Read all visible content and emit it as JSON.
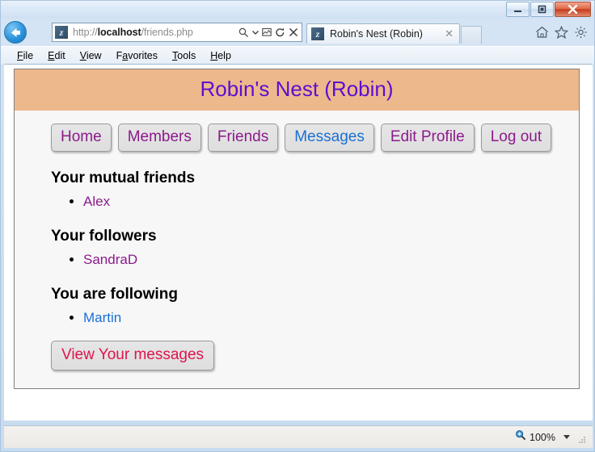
{
  "browser": {
    "window_buttons": {
      "minimize": "minimize-icon",
      "restore": "restore-icon",
      "close": "close-icon"
    },
    "navigation": {
      "back": "back-arrow-icon",
      "forward": "forward-arrow-icon"
    },
    "address": {
      "favicon": "z",
      "url_prefix": "http://",
      "url_host": "localhost",
      "url_path": "/friends.php",
      "full_url": "http://localhost/friends.php",
      "icons": [
        "search-icon",
        "dropdown-caret-icon",
        "compatibility-view-icon",
        "refresh-icon",
        "stop-icon"
      ]
    },
    "tab": {
      "favicon": "z",
      "title": "Robin's Nest (Robin)",
      "close_label": "✕"
    },
    "toolbar_icons": [
      "home-icon",
      "favorites-star-icon",
      "tools-gear-icon"
    ],
    "menu": [
      {
        "label": "File",
        "accel": "F",
        "rest": "ile"
      },
      {
        "label": "Edit",
        "accel": "E",
        "rest": "dit"
      },
      {
        "label": "View",
        "accel": "V",
        "rest": "iew"
      },
      {
        "label": "Favorites",
        "accel": "a",
        "pre": "F",
        "rest": "vorites"
      },
      {
        "label": "Tools",
        "accel": "T",
        "rest": "ools"
      },
      {
        "label": "Help",
        "accel": "H",
        "rest": "elp"
      }
    ],
    "status": {
      "zoom_icon": "zoom-magnifier-icon",
      "zoom_level": "100%",
      "resize_grip": "resize-grip-icon"
    }
  },
  "page": {
    "title": "Robin's Nest (Robin)",
    "header_bg": "#eeb88d",
    "title_color": "#5b0fd0",
    "nav": [
      {
        "label": "Home",
        "state": "visited"
      },
      {
        "label": "Members",
        "state": "visited"
      },
      {
        "label": "Friends",
        "state": "visited"
      },
      {
        "label": "Messages",
        "state": "unvisited"
      },
      {
        "label": "Edit Profile",
        "state": "visited"
      },
      {
        "label": "Log out",
        "state": "visited"
      }
    ],
    "sections": [
      {
        "heading": "Your mutual friends",
        "people": [
          {
            "name": "Alex",
            "state": "visited"
          }
        ]
      },
      {
        "heading": "Your followers",
        "people": [
          {
            "name": "SandraD",
            "state": "visited"
          }
        ]
      },
      {
        "heading": "You are following",
        "people": [
          {
            "name": "Martin",
            "state": "unvisited"
          }
        ]
      }
    ],
    "messages_button": {
      "label": "View Your messages",
      "color": "#e0144c"
    },
    "link_colors": {
      "visited": "#8b1a8b",
      "unvisited": "#1a6fd4"
    }
  }
}
